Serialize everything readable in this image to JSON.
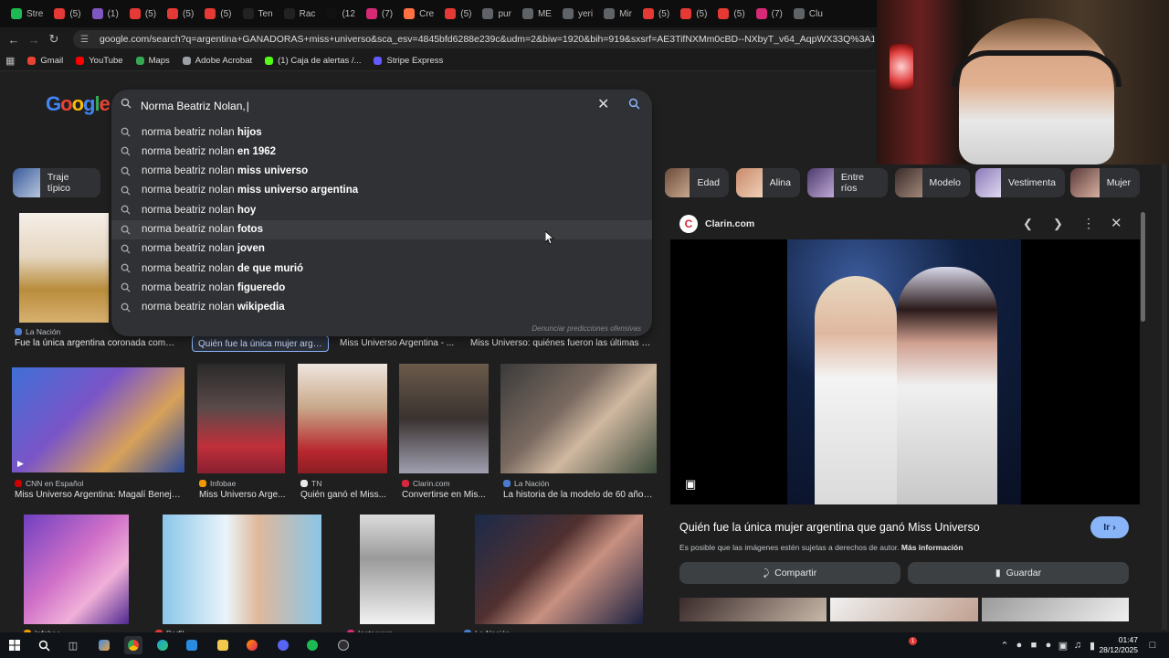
{
  "browser": {
    "tabs": [
      {
        "label": "Stre",
        "color": "#1db954"
      },
      {
        "label": "(5)",
        "color": "#e53935"
      },
      {
        "label": "(1)",
        "color": "#7e57c2"
      },
      {
        "label": "(5)",
        "color": "#e53935"
      },
      {
        "label": "(5)",
        "color": "#e53935"
      },
      {
        "label": "(5)",
        "color": "#e53935"
      },
      {
        "label": "Ten",
        "color": "#222222"
      },
      {
        "label": "Rac",
        "color": "#222222"
      },
      {
        "label": "(12",
        "color": "#111111"
      },
      {
        "label": "(7)",
        "color": "#d62976"
      },
      {
        "label": "Cre",
        "color": "#ff7043"
      },
      {
        "label": "(5)",
        "color": "#e53935"
      },
      {
        "label": "pur",
        "color": "#5f6368"
      },
      {
        "label": "ME",
        "color": "#5f6368"
      },
      {
        "label": "yeri",
        "color": "#5f6368"
      },
      {
        "label": "Mir",
        "color": "#5f6368"
      },
      {
        "label": "(5)",
        "color": "#e53935"
      },
      {
        "label": "(5)",
        "color": "#e53935"
      },
      {
        "label": "(5)",
        "color": "#e53935"
      },
      {
        "label": "(7)",
        "color": "#d62976"
      },
      {
        "label": "Clu",
        "color": "#5f6368"
      }
    ],
    "url": "google.com/search?q=argentina+GANADORAS+miss+universo&sca_esv=4845bfd6288e239c&udm=2&biw=1920&bih=919&sxsrf=AE3TifNXMm0cBD--NXbyT_v64_AqpWX33Q%3A1766897162902&ei=CrZQ",
    "bookmarks": [
      {
        "label": "Gmail",
        "color": "#ea4335"
      },
      {
        "label": "YouTube",
        "color": "#ff0000"
      },
      {
        "label": "Maps",
        "color": "#34a853"
      },
      {
        "label": "Adobe Acrobat",
        "color": "#9aa0a6"
      },
      {
        "label": "(1) Caja de alertas /...",
        "color": "#53fc18"
      },
      {
        "label": "Stripe Express",
        "color": "#635bff"
      }
    ]
  },
  "search": {
    "logo": "Google",
    "query": "Norma Beatriz Nolan,",
    "prefix": "norma beatriz nolan",
    "suggestions": [
      {
        "suffix": "hijos"
      },
      {
        "suffix": "en 1962"
      },
      {
        "suffix": "miss universo"
      },
      {
        "suffix": "miss universo argentina"
      },
      {
        "suffix": "hoy"
      },
      {
        "suffix": "fotos"
      },
      {
        "suffix": "joven"
      },
      {
        "suffix": "de que murió"
      },
      {
        "suffix": "figueredo"
      },
      {
        "suffix": "wikipedia"
      }
    ],
    "report_link": "Denunciar predicciones ofensivas"
  },
  "chips": [
    {
      "label": "Traje típico"
    },
    {
      "label": "Edad"
    },
    {
      "label": "Alina"
    },
    {
      "label": "Entre ríos"
    },
    {
      "label": "Modelo"
    },
    {
      "label": "Vestimenta"
    },
    {
      "label": "Mujer"
    }
  ],
  "results": {
    "row1": [
      {
        "source": "La Nación",
        "caption": "Fue la única argentina coronada como ..."
      },
      {
        "source": "",
        "caption": "Quién fue la única mujer arge..."
      },
      {
        "source": "",
        "caption": "Miss Universo Argentina - ..."
      },
      {
        "source": "",
        "caption": "Miss Universo: quiénes fueron las últimas ci..."
      }
    ],
    "row2": [
      {
        "source": "CNN en Español",
        "caption": "Miss Universo Argentina: Magalí Beneja..."
      },
      {
        "source": "Infobae",
        "caption": "Miss Universo Arge..."
      },
      {
        "source": "TN",
        "caption": "Quién ganó el Miss..."
      },
      {
        "source": "Clarin.com",
        "caption": "Convertirse en Mis..."
      },
      {
        "source": "La Nación",
        "caption": "La historia de la modelo de 60 años ..."
      }
    ],
    "row3_sources": [
      "Infobae",
      "Perfil",
      "Instagram",
      "La Nación"
    ]
  },
  "preview": {
    "source": "Clarin.com",
    "title": "Quién fue la única mujer argentina que ganó Miss Universo",
    "visit_label": "Ir",
    "notice": "Es posible que las imágenes estén sujetas a derechos de autor.",
    "more_info": "Más información",
    "share_label": "Compartir",
    "save_label": "Guardar"
  },
  "taskbar": {
    "time": "01:47",
    "date": "28/12/2025",
    "notification_count": "1"
  }
}
